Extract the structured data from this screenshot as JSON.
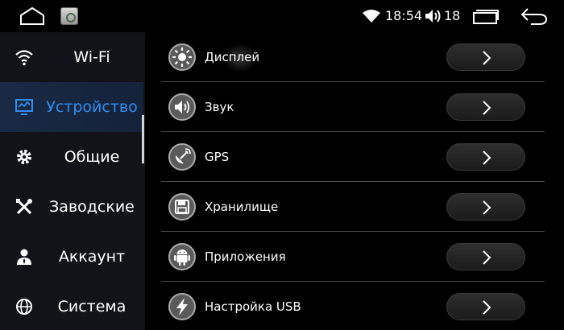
{
  "status_bar": {
    "time": "18:54",
    "volume": "18",
    "icons": [
      "home-icon",
      "app-thumbnail-icon",
      "wifi-icon",
      "volume-icon",
      "recent-apps-icon",
      "back-icon"
    ]
  },
  "sidebar": {
    "items": [
      {
        "label": "Wi-Fi",
        "icon": "wifi-icon"
      },
      {
        "label": "Устройство",
        "icon": "device-monitor-icon",
        "active": true
      },
      {
        "label": "Общие",
        "icon": "gear-icon"
      },
      {
        "label": "Заводские",
        "icon": "tools-icon"
      },
      {
        "label": "Аккаунт",
        "icon": "account-icon"
      },
      {
        "label": "Система",
        "icon": "globe-icon"
      }
    ]
  },
  "menu": {
    "items": [
      {
        "label": "Дисплей",
        "icon": "brightness-icon"
      },
      {
        "label": "Звук",
        "icon": "speaker-icon"
      },
      {
        "label": "GPS",
        "icon": "satellite-icon"
      },
      {
        "label": "Хранилище",
        "icon": "floppy-disk-icon"
      },
      {
        "label": "Приложения",
        "icon": "android-icon"
      },
      {
        "label": "Настройка USB",
        "icon": "usb-bolt-icon"
      }
    ]
  },
  "colors": {
    "accent": "#2b8ff0",
    "background": "#000000",
    "sidebar_bg": "#111318",
    "active_bg": "#1a2a44"
  }
}
